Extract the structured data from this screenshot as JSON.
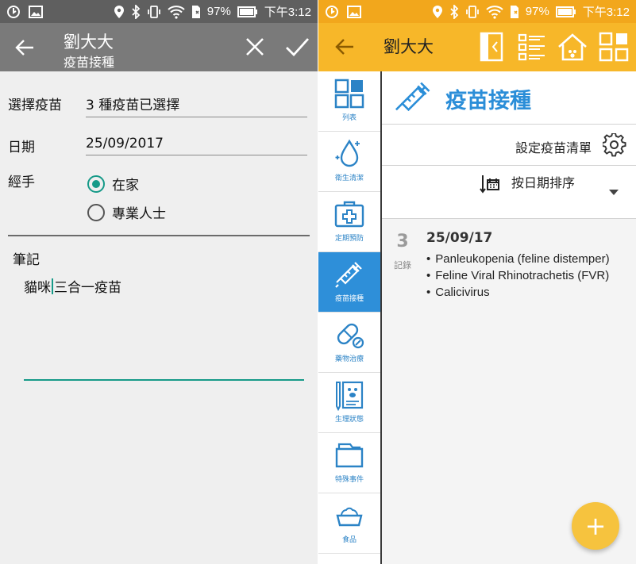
{
  "status_bar": {
    "battery": "97%",
    "time": "下午3:12"
  },
  "editor": {
    "title": "劉大大",
    "subtitle": "疫苗接種",
    "vaccine_label": "選擇疫苗",
    "vaccine_value": "3 種疫苗已選擇",
    "date_label": "日期",
    "date_value": "25/09/2017",
    "handler_label": "經手",
    "handler_options": [
      {
        "label": "在家",
        "checked": true
      },
      {
        "label": "專業人士",
        "checked": false
      }
    ],
    "notes_label": "筆記",
    "notes_before_cursor": "貓咪",
    "notes_after_cursor": "三合一疫苗"
  },
  "app": {
    "title": "劉大大",
    "sidebar": [
      {
        "label": "列表",
        "icon": "grid-icon"
      },
      {
        "label": "衛生清潔",
        "icon": "droplet-icon"
      },
      {
        "label": "定期預防",
        "icon": "first-aid-kit-icon"
      },
      {
        "label": "疫苗接種",
        "icon": "syringe-icon",
        "active": true
      },
      {
        "label": "藥物治療",
        "icon": "pill-icon"
      },
      {
        "label": "生理狀態",
        "icon": "clipboard-paw-icon"
      },
      {
        "label": "特殊事件",
        "icon": "folder-icon"
      },
      {
        "label": "食品",
        "icon": "food-bowl-icon"
      }
    ],
    "page_title": "疫苗接種",
    "settings_label": "設定疫苗清單",
    "sort_label": "按日期排序",
    "record": {
      "count": "3",
      "count_label": "記錄",
      "date": "25/09/17",
      "vaccines": [
        "Panleukopenia (feline distemper)",
        "Feline Viral Rhinotrachetis (FVR)",
        "Calicivirus"
      ]
    },
    "fab_label": "+"
  },
  "colors": {
    "left_status": "#5f5f5f",
    "left_appbar": "#7a7a7a",
    "right_status": "#f2a71c",
    "right_appbar": "#f7b729",
    "accent_teal": "#169a88",
    "accent_blue": "#2e8fd9",
    "fab": "#f6c33e"
  }
}
